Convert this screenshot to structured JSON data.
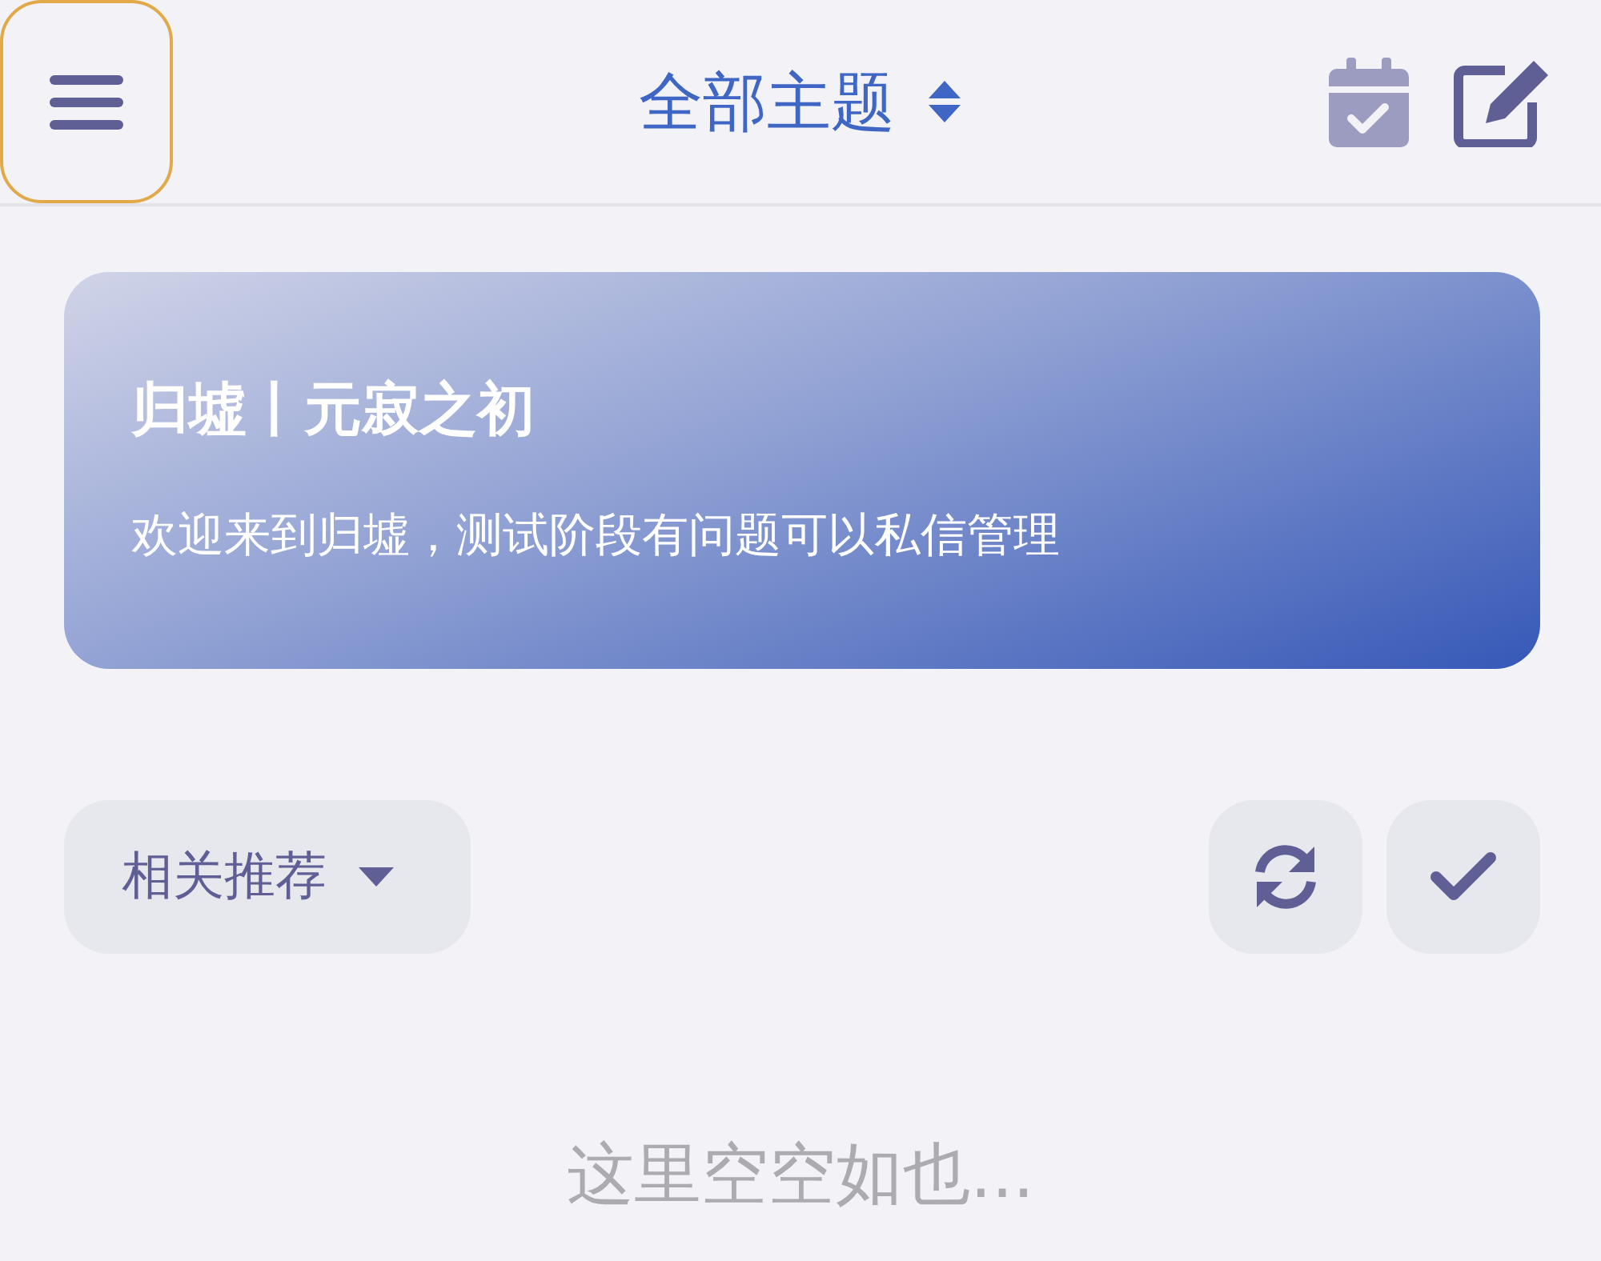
{
  "header": {
    "menu_button": {
      "focused": true
    },
    "title": "全部主题"
  },
  "banner": {
    "title": "归墟丨元寂之初",
    "subtitle": "欢迎来到归墟，测试阶段有问题可以私信管理"
  },
  "filter": {
    "label": "相关推荐"
  },
  "empty_message": "这里空空如也..."
}
